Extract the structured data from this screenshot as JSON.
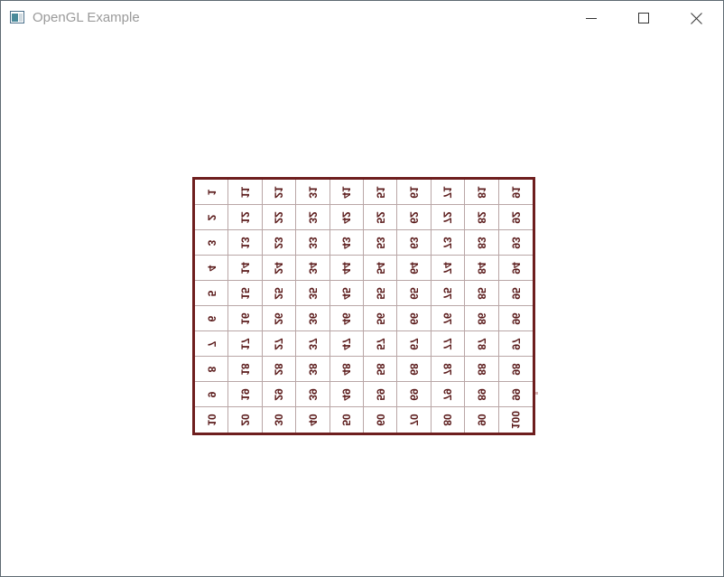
{
  "window": {
    "title": "OpenGL Example"
  },
  "icons": {
    "app": "opengl-window-icon",
    "minimize": "minimize-icon",
    "maximize": "maximize-icon",
    "close": "close-icon"
  },
  "colors": {
    "board_border": "#6e1e1e",
    "number_text": "#5a1a1a",
    "grid_line": "#b9a6a6"
  },
  "board": {
    "rows": 10,
    "columns": 10,
    "cells": [
      "1",
      "11",
      "21",
      "31",
      "41",
      "51",
      "61",
      "71",
      "81",
      "91",
      "2",
      "12",
      "22",
      "32",
      "42",
      "52",
      "62",
      "72",
      "82",
      "92",
      "3",
      "13",
      "23",
      "33",
      "43",
      "53",
      "63",
      "73",
      "83",
      "93",
      "4",
      "14",
      "24",
      "34",
      "44",
      "54",
      "64",
      "74",
      "84",
      "94",
      "5",
      "15",
      "25",
      "35",
      "45",
      "55",
      "65",
      "75",
      "85",
      "95",
      "6",
      "16",
      "26",
      "36",
      "46",
      "56",
      "66",
      "76",
      "86",
      "96",
      "7",
      "17",
      "27",
      "37",
      "47",
      "57",
      "67",
      "77",
      "87",
      "97",
      "8",
      "18",
      "28",
      "38",
      "48",
      "58",
      "68",
      "78",
      "88",
      "98",
      "9",
      "19",
      "29",
      "39",
      "49",
      "59",
      "69",
      "79",
      "89",
      "99",
      "10",
      "20",
      "30",
      "40",
      "50",
      "60",
      "70",
      "80",
      "90",
      "100"
    ]
  }
}
